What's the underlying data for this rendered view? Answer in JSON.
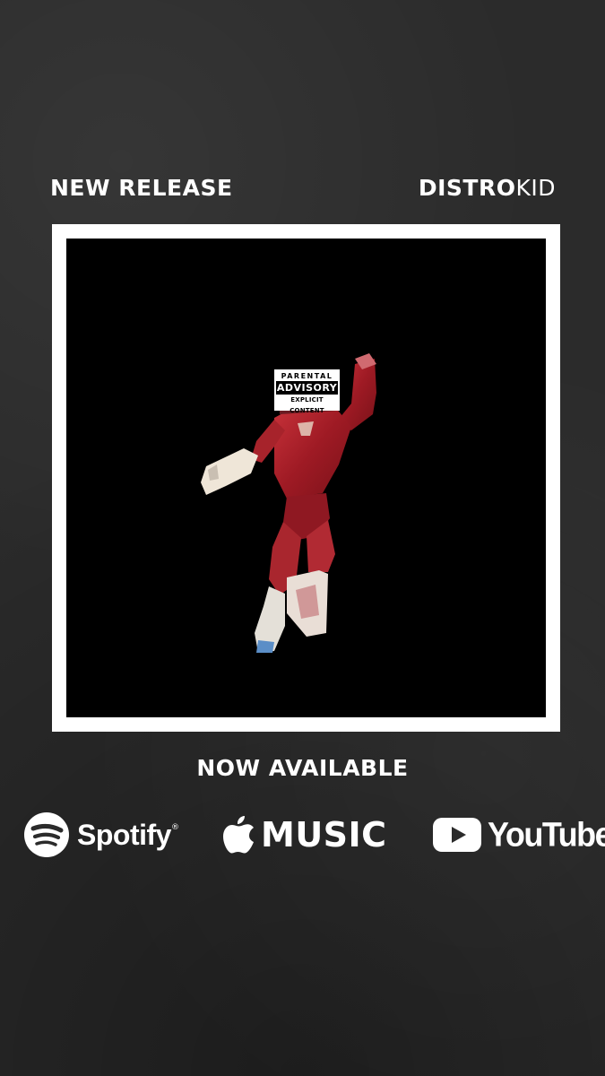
{
  "header": {
    "left_label": "NEW RELEASE",
    "brand": {
      "bold": "DISTRO",
      "light": "KID"
    }
  },
  "advisory": {
    "line1": "PARENTAL",
    "line2": "ADVISORY",
    "line3": "EXPLICIT CONTENT"
  },
  "availability_label": "NOW AVAILABLE",
  "services": [
    {
      "name": "Spotify",
      "mark": "®",
      "icon": "spotify-icon"
    },
    {
      "name": "MUSIC",
      "icon": "apple-icon"
    },
    {
      "name": "YouTube",
      "icon": "youtube-play-icon"
    }
  ],
  "colors": {
    "background": "#2b2b2b",
    "frame": "#ffffff",
    "artwork": "#000000",
    "figure_red": "#b3202a"
  }
}
